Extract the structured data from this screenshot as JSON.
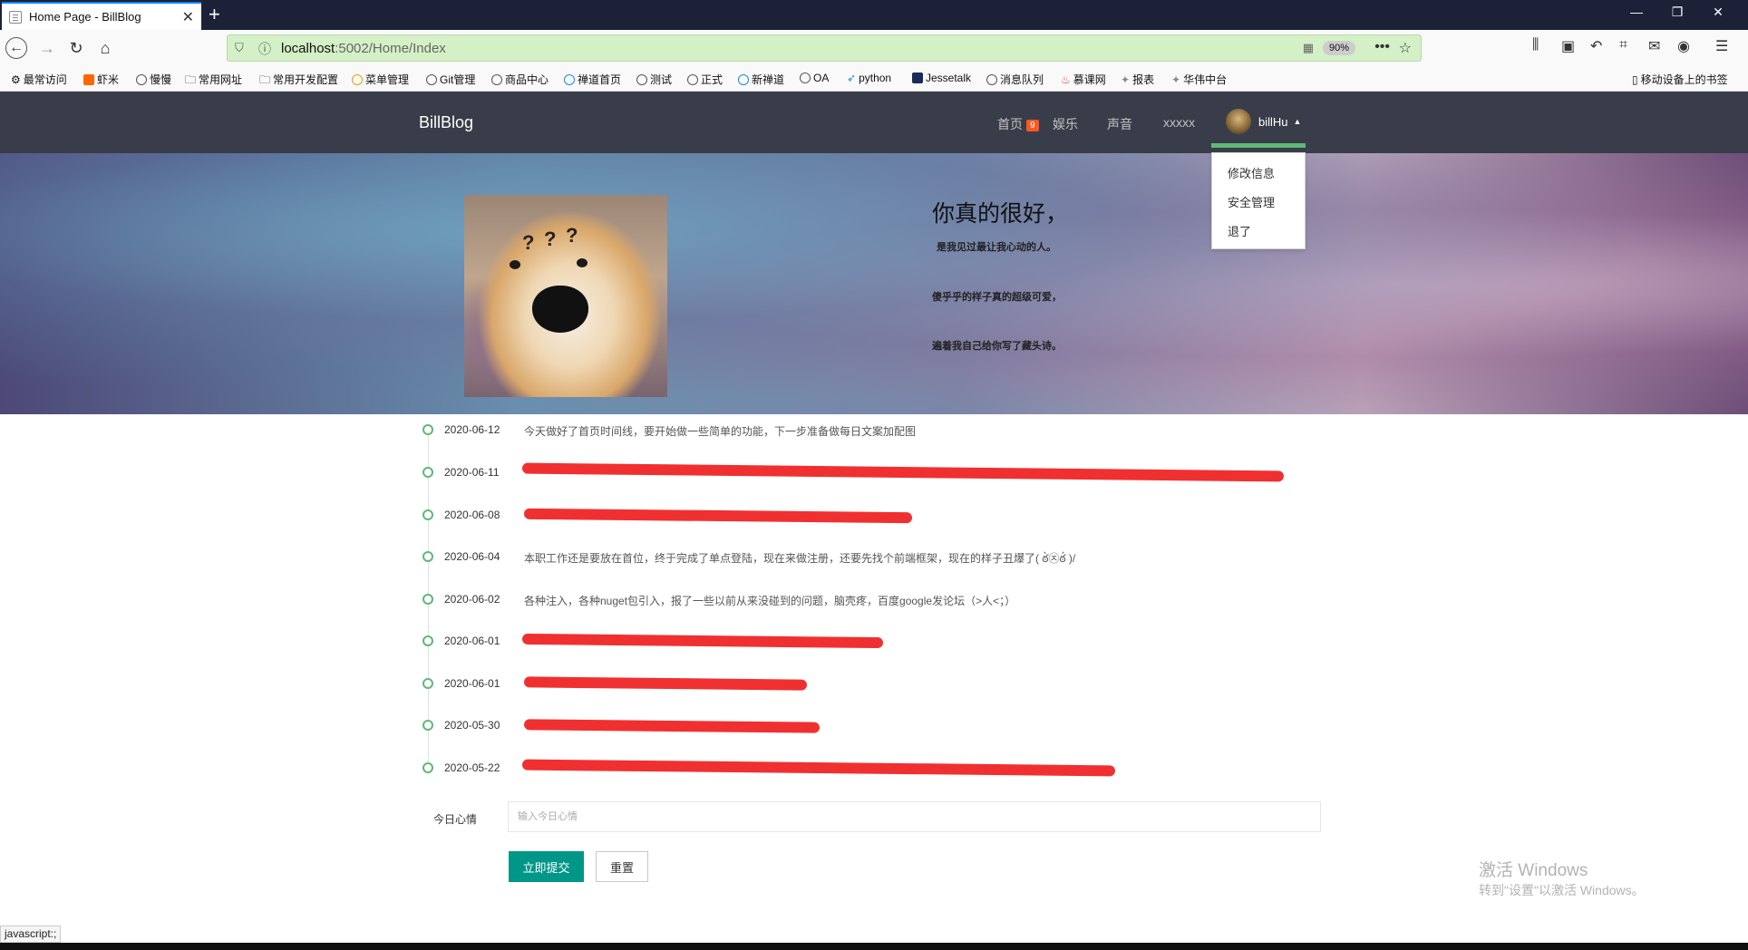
{
  "browser": {
    "tab_title": "Home Page - BillBlog",
    "url_host": "localhost",
    "url_path": ":5002/Home/Index",
    "zoom": "90%",
    "status_text": "javascript:;",
    "bookmarks": [
      "最常访问",
      "虾米",
      "慢慢",
      "常用网址",
      "常用开发配置",
      "菜单管理",
      "Git管理",
      "商品中心",
      "禅道首页",
      "测试",
      "正式",
      "新禅道",
      "OA",
      "python",
      "Jessetalk",
      "消息队列",
      "慕课网",
      "报表",
      "华伟中台"
    ],
    "mobile_bookmarks": "移动设备上的书签"
  },
  "site": {
    "brand": "BillBlog",
    "nav": {
      "home": "首页",
      "home_badge": "9",
      "ent": "娱乐",
      "voice": "声音",
      "xx": "xxxxx"
    },
    "user": {
      "name": "billHu",
      "menu": [
        "修改信息",
        "安全管理",
        "退了"
      ]
    }
  },
  "hero": {
    "heading": "你真的很好，",
    "lines": [
      "是我见过最让我心动的人。",
      "傻乎乎的样子真的超级可爱，",
      "遍着我自己给你写了藏头诗。"
    ]
  },
  "timeline": [
    {
      "date": "2020-06-12",
      "text": "今天做好了首页时间线，要开始做一些简单的功能，下一步准备做每日文案加配图",
      "redacted": false
    },
    {
      "date": "2020-06-11",
      "text": "",
      "redacted": true
    },
    {
      "date": "2020-06-08",
      "text": "",
      "redacted": true
    },
    {
      "date": "2020-06-04",
      "text": "本职工作还是要放在首位，终于完成了单点登陆，现在来做注册，还要先找个前端框架，现在的样子丑爆了( ఠ̀㉨ఠ́ )/",
      "redacted": false
    },
    {
      "date": "2020-06-02",
      "text": "各种注入，各种nuget包引入，报了一些以前从来没碰到的问题，脑壳疼，百度google发论坛（>人<；）",
      "redacted": false
    },
    {
      "date": "2020-06-01",
      "text": "",
      "redacted": true
    },
    {
      "date": "2020-06-01",
      "text": "",
      "redacted": true
    },
    {
      "date": "2020-05-30",
      "text": "",
      "redacted": true
    },
    {
      "date": "2020-05-22",
      "text": "",
      "redacted": true
    }
  ],
  "form": {
    "label": "今日心情",
    "placeholder": "输入今日心情",
    "submit": "立即提交",
    "reset": "重置"
  },
  "watermark": {
    "line1": "激活 Windows",
    "line2": "转到\"设置\"以激活 Windows。"
  }
}
